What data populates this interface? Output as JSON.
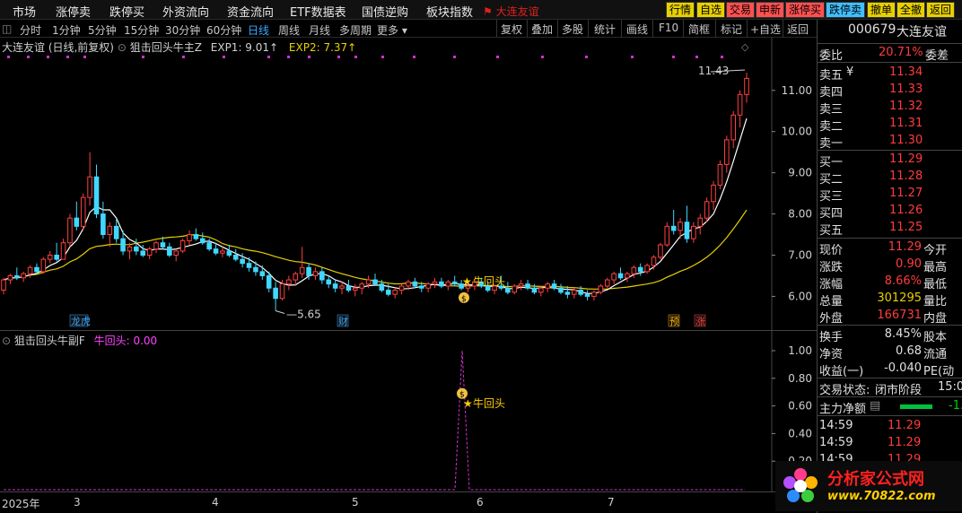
{
  "menu": {
    "items": [
      "市场",
      "涨停卖",
      "跌停买",
      "外资流向",
      "资金流向",
      "ETF数据表",
      "国债逆购",
      "板块指数"
    ],
    "stock_title": "大连友谊",
    "buttons": [
      {
        "label": "行情",
        "color": "#e8d000"
      },
      {
        "label": "自选",
        "color": "#e8d000"
      },
      {
        "label": "交易",
        "color": "#ff5050"
      },
      {
        "label": "申新",
        "color": "#ff5050"
      },
      {
        "label": "涨停买",
        "color": "#ff5050"
      },
      {
        "label": "跌停卖",
        "color": "#40c0ff"
      },
      {
        "label": "撤单",
        "color": "#e8d000"
      },
      {
        "label": "全撤",
        "color": "#e8d000"
      },
      {
        "label": "返回",
        "color": "#e8d000"
      }
    ]
  },
  "periods": {
    "items": [
      "分时",
      "1分钟",
      "5分钟",
      "15分钟",
      "30分钟",
      "60分钟",
      "日线",
      "周线",
      "月线",
      "多周期",
      "更多"
    ],
    "active": "日线"
  },
  "tools": [
    "复权",
    "叠加",
    "多股",
    "统计",
    "画线",
    "F10",
    "简框",
    "标记",
    "+自选",
    "返回"
  ],
  "main_chart": {
    "stock_label": "大连友谊 (日线,前复权)",
    "indicator_name": "狙击回头牛主Z",
    "exp1_label": "EXP1: 9.01↑",
    "exp2_label": "EXP2: 7.37↑",
    "high_label": "11.43",
    "low_label": "5.65",
    "signal_label": "牛回头",
    "badges": [
      "龙虎",
      "财",
      "预",
      "涨"
    ],
    "y_ticks": [
      "11.00",
      "10.00",
      "9.00",
      "8.00",
      "7.00",
      "6.00"
    ]
  },
  "sub_chart": {
    "indicator_name": "狙击回头牛副F",
    "value_label": "牛回头: 0.00",
    "signal_label": "牛回头",
    "y_ticks": [
      "1.00",
      "0.80",
      "0.60",
      "0.40",
      "0.20"
    ]
  },
  "date_axis": {
    "year": "2025年",
    "months": [
      "3",
      "4",
      "5",
      "6",
      "7"
    ]
  },
  "quote_panel": {
    "code": "000679",
    "name": "大连友谊",
    "weibi_label": "委比",
    "weibi_value": "20.71%",
    "weicha_label": "委差",
    "asks": [
      {
        "label": "卖五",
        "price": "11.34"
      },
      {
        "label": "卖四",
        "price": "11.33"
      },
      {
        "label": "卖三",
        "price": "11.32"
      },
      {
        "label": "卖二",
        "price": "11.31"
      },
      {
        "label": "卖一",
        "price": "11.30"
      }
    ],
    "yen_sign": "¥",
    "bids": [
      {
        "label": "买一",
        "price": "11.29"
      },
      {
        "label": "买二",
        "price": "11.28"
      },
      {
        "label": "买三",
        "price": "11.27"
      },
      {
        "label": "买四",
        "price": "11.26"
      },
      {
        "label": "买五",
        "price": "11.25"
      }
    ],
    "stats": [
      {
        "label": "现价",
        "value": "11.29",
        "value_color": "red",
        "label2": "今开"
      },
      {
        "label": "涨跌",
        "value": "0.90",
        "value_color": "red",
        "label2": "最高"
      },
      {
        "label": "涨幅",
        "value": "8.66%",
        "value_color": "red",
        "label2": "最低"
      },
      {
        "label": "总量",
        "value": "301295",
        "value_color": "yellow",
        "label2": "量比"
      },
      {
        "label": "外盘",
        "value": "166731",
        "value_color": "red",
        "label2": "内盘"
      }
    ],
    "stats2": [
      {
        "label": "换手",
        "value": "8.45%",
        "value_color": "white",
        "label2": "股本"
      },
      {
        "label": "净资",
        "value": "0.68",
        "value_color": "white",
        "label2": "流通"
      },
      {
        "label": "收益(一)",
        "value": "-0.040",
        "value_color": "white",
        "label2": "PE(动"
      }
    ],
    "trade_status_label": "交易状态:",
    "trade_status_value": "闭市阶段",
    "trade_status_time": "15:0",
    "main_flow_label": "主力净额",
    "main_flow_value": "-1.",
    "ticks": [
      {
        "time": "14:59",
        "price": "11.29"
      },
      {
        "time": "14:59",
        "price": "11.29"
      },
      {
        "time": "14:59",
        "price": "11.29"
      }
    ]
  },
  "watermark": {
    "title": "分析家公式网",
    "url": "www.70822.com"
  },
  "chart_data": {
    "type": "candlestick",
    "y_range": [
      5.4,
      11.8
    ],
    "candles": [
      [
        6.15,
        6.45,
        6.05,
        6.4
      ],
      [
        6.4,
        6.55,
        6.3,
        6.5
      ],
      [
        6.5,
        6.7,
        6.4,
        6.45
      ],
      [
        6.45,
        6.6,
        6.35,
        6.55
      ],
      [
        6.55,
        6.75,
        6.45,
        6.7
      ],
      [
        6.7,
        6.8,
        6.55,
        6.6
      ],
      [
        6.6,
        6.95,
        6.55,
        6.9
      ],
      [
        6.9,
        7.1,
        6.8,
        7.0
      ],
      [
        7.0,
        7.3,
        6.85,
        6.9
      ],
      [
        6.9,
        7.4,
        6.9,
        7.3
      ],
      [
        7.3,
        8.0,
        7.2,
        7.9
      ],
      [
        7.9,
        8.3,
        7.6,
        7.7
      ],
      [
        7.7,
        8.5,
        7.6,
        8.4
      ],
      [
        8.4,
        9.5,
        8.2,
        8.9
      ],
      [
        8.9,
        9.2,
        7.9,
        8.0
      ],
      [
        8.0,
        8.3,
        7.4,
        7.5
      ],
      [
        7.5,
        7.8,
        7.2,
        7.7
      ],
      [
        7.7,
        7.9,
        7.3,
        7.4
      ],
      [
        7.4,
        7.6,
        7.0,
        7.1
      ],
      [
        7.1,
        7.3,
        6.9,
        7.2
      ],
      [
        7.2,
        7.4,
        7.0,
        7.1
      ],
      [
        7.1,
        7.25,
        6.95,
        7.0
      ],
      [
        7.0,
        7.2,
        6.9,
        7.15
      ],
      [
        7.15,
        7.35,
        7.05,
        7.3
      ],
      [
        7.3,
        7.45,
        7.15,
        7.2
      ],
      [
        7.2,
        7.3,
        6.95,
        7.0
      ],
      [
        7.0,
        7.15,
        6.85,
        7.1
      ],
      [
        7.1,
        7.4,
        7.05,
        7.35
      ],
      [
        7.35,
        7.6,
        7.25,
        7.5
      ],
      [
        7.5,
        7.65,
        7.35,
        7.4
      ],
      [
        7.4,
        7.55,
        7.25,
        7.3
      ],
      [
        7.3,
        7.4,
        7.1,
        7.15
      ],
      [
        7.15,
        7.3,
        7.0,
        7.05
      ],
      [
        7.05,
        7.2,
        6.95,
        7.1
      ],
      [
        7.1,
        7.25,
        6.95,
        7.0
      ],
      [
        7.0,
        7.15,
        6.85,
        6.9
      ],
      [
        6.9,
        7.05,
        6.7,
        6.8
      ],
      [
        6.8,
        6.95,
        6.6,
        6.7
      ],
      [
        6.7,
        6.85,
        6.5,
        6.6
      ],
      [
        6.6,
        6.75,
        6.4,
        6.5
      ],
      [
        6.5,
        6.6,
        6.1,
        6.2
      ],
      [
        6.2,
        6.35,
        5.65,
        5.95
      ],
      [
        5.95,
        6.4,
        5.9,
        6.3
      ],
      [
        6.3,
        6.5,
        6.15,
        6.4
      ],
      [
        6.4,
        6.6,
        6.25,
        6.55
      ],
      [
        6.55,
        7.2,
        6.45,
        6.7
      ],
      [
        6.7,
        6.8,
        6.4,
        6.5
      ],
      [
        6.5,
        6.7,
        6.4,
        6.6
      ],
      [
        6.6,
        6.7,
        6.3,
        6.4
      ],
      [
        6.4,
        6.5,
        6.2,
        6.3
      ],
      [
        6.3,
        6.4,
        6.1,
        6.2
      ],
      [
        6.2,
        6.35,
        6.05,
        6.25
      ],
      [
        6.25,
        6.4,
        6.1,
        6.15
      ],
      [
        6.15,
        6.3,
        6.0,
        6.2
      ],
      [
        6.2,
        6.35,
        6.05,
        6.3
      ],
      [
        6.3,
        6.5,
        6.2,
        6.4
      ],
      [
        6.4,
        6.55,
        6.25,
        6.3
      ],
      [
        6.3,
        6.4,
        6.1,
        6.15
      ],
      [
        6.15,
        6.3,
        6.0,
        6.05
      ],
      [
        6.05,
        6.2,
        5.95,
        6.15
      ],
      [
        6.15,
        6.3,
        6.05,
        6.25
      ],
      [
        6.25,
        6.4,
        6.15,
        6.35
      ],
      [
        6.35,
        6.45,
        6.2,
        6.25
      ],
      [
        6.25,
        6.35,
        6.1,
        6.2
      ],
      [
        6.2,
        6.35,
        6.1,
        6.3
      ],
      [
        6.3,
        6.45,
        6.2,
        6.35
      ],
      [
        6.35,
        6.45,
        6.2,
        6.25
      ],
      [
        6.25,
        6.4,
        6.15,
        6.35
      ],
      [
        6.35,
        6.5,
        6.25,
        6.3
      ],
      [
        6.3,
        6.4,
        6.15,
        6.2
      ],
      [
        6.2,
        6.35,
        6.1,
        6.25
      ],
      [
        6.25,
        6.4,
        6.15,
        6.35
      ],
      [
        6.35,
        6.45,
        6.2,
        6.25
      ],
      [
        6.25,
        6.35,
        6.1,
        6.15
      ],
      [
        6.15,
        6.3,
        6.05,
        6.25
      ],
      [
        6.25,
        6.5,
        6.15,
        6.2
      ],
      [
        6.2,
        6.35,
        6.05,
        6.1
      ],
      [
        6.1,
        6.3,
        6.05,
        6.25
      ],
      [
        6.25,
        6.4,
        6.15,
        6.3
      ],
      [
        6.3,
        6.4,
        6.15,
        6.2
      ],
      [
        6.2,
        6.3,
        6.05,
        6.1
      ],
      [
        6.1,
        6.25,
        6.0,
        6.2
      ],
      [
        6.2,
        6.35,
        6.1,
        6.3
      ],
      [
        6.3,
        6.4,
        6.15,
        6.2
      ],
      [
        6.2,
        6.3,
        6.05,
        6.1
      ],
      [
        6.1,
        6.25,
        5.95,
        6.05
      ],
      [
        6.05,
        6.2,
        5.95,
        6.15
      ],
      [
        6.15,
        6.25,
        6.0,
        6.05
      ],
      [
        6.05,
        6.15,
        5.9,
        6.0
      ],
      [
        6.0,
        6.15,
        5.9,
        6.1
      ],
      [
        6.1,
        6.3,
        6.05,
        6.25
      ],
      [
        6.25,
        6.45,
        6.2,
        6.4
      ],
      [
        6.4,
        6.6,
        6.3,
        6.55
      ],
      [
        6.55,
        6.7,
        6.4,
        6.45
      ],
      [
        6.45,
        6.6,
        6.35,
        6.55
      ],
      [
        6.55,
        6.75,
        6.45,
        6.7
      ],
      [
        6.7,
        6.8,
        6.5,
        6.6
      ],
      [
        6.6,
        6.8,
        6.55,
        6.75
      ],
      [
        6.75,
        7.0,
        6.65,
        6.95
      ],
      [
        6.95,
        7.3,
        6.9,
        7.25
      ],
      [
        7.25,
        7.8,
        7.2,
        7.7
      ],
      [
        7.7,
        8.1,
        7.5,
        7.6
      ],
      [
        7.6,
        7.9,
        7.4,
        7.8
      ],
      [
        7.8,
        8.2,
        7.3,
        7.4
      ],
      [
        7.4,
        7.8,
        7.3,
        7.7
      ],
      [
        7.7,
        8.0,
        7.5,
        7.9
      ],
      [
        7.9,
        8.4,
        7.8,
        8.3
      ],
      [
        8.3,
        8.8,
        8.1,
        8.7
      ],
      [
        8.7,
        9.3,
        8.6,
        9.2
      ],
      [
        9.2,
        9.9,
        9.0,
        9.8
      ],
      [
        9.8,
        10.5,
        9.6,
        10.4
      ],
      [
        10.4,
        11.0,
        10.1,
        10.9
      ],
      [
        10.9,
        11.43,
        10.7,
        11.29
      ]
    ],
    "ma_white_desc": "short moving average",
    "ma_yellow_desc": "long moving average"
  }
}
